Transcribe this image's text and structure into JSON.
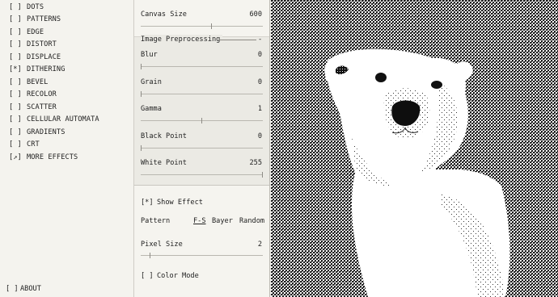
{
  "menu": {
    "items": [
      {
        "box": "[ ]",
        "label": "DOTS"
      },
      {
        "box": "[ ]",
        "label": "PATTERNS"
      },
      {
        "box": "[ ]",
        "label": "EDGE"
      },
      {
        "box": "[ ]",
        "label": "DISTORT"
      },
      {
        "box": "[ ]",
        "label": "DISPLACE"
      },
      {
        "box": "[*]",
        "label": "DITHERING"
      },
      {
        "box": "[ ]",
        "label": "BEVEL"
      },
      {
        "box": "[ ]",
        "label": "RECOLOR"
      },
      {
        "box": "[ ]",
        "label": "SCATTER"
      },
      {
        "box": "[ ]",
        "label": "CELLULAR AUTOMATA"
      },
      {
        "box": "[ ]",
        "label": "GRADIENTS"
      },
      {
        "box": "[ ]",
        "label": "CRT"
      },
      {
        "box": "[↗]",
        "label": "MORE EFFECTS"
      }
    ],
    "about": {
      "box": "[ ]",
      "label": "ABOUT"
    }
  },
  "settings": {
    "canvas_size": {
      "label": "Canvas Size",
      "value": "600",
      "level": 0.58
    },
    "preprocessing": {
      "title": "Image Preprocessing",
      "collapse": "-",
      "blur": {
        "label": "Blur",
        "value": "0",
        "level": 0.0
      },
      "grain": {
        "label": "Grain",
        "value": "0",
        "level": 0.0
      },
      "gamma": {
        "label": "Gamma",
        "value": "1",
        "level": 0.5
      },
      "black_point": {
        "label": "Black Point",
        "value": "0",
        "level": 0.0
      },
      "white_point": {
        "label": "White Point",
        "value": "255",
        "level": 1.0
      }
    },
    "show_effect": {
      "box": "[*]",
      "label": "Show Effect"
    },
    "pattern": {
      "label": "Pattern",
      "options": [
        "F-S",
        "Bayer",
        "Random"
      ],
      "selected": "F-S"
    },
    "pixel_size": {
      "label": "Pixel Size",
      "value": "2",
      "level": 0.07
    },
    "color_mode": {
      "box": "[ ]",
      "label": "Color Mode"
    }
  },
  "canvas": {
    "subject": "dithered polar bear",
    "foreground": "#ffffff",
    "background": "#1a1a1a"
  }
}
